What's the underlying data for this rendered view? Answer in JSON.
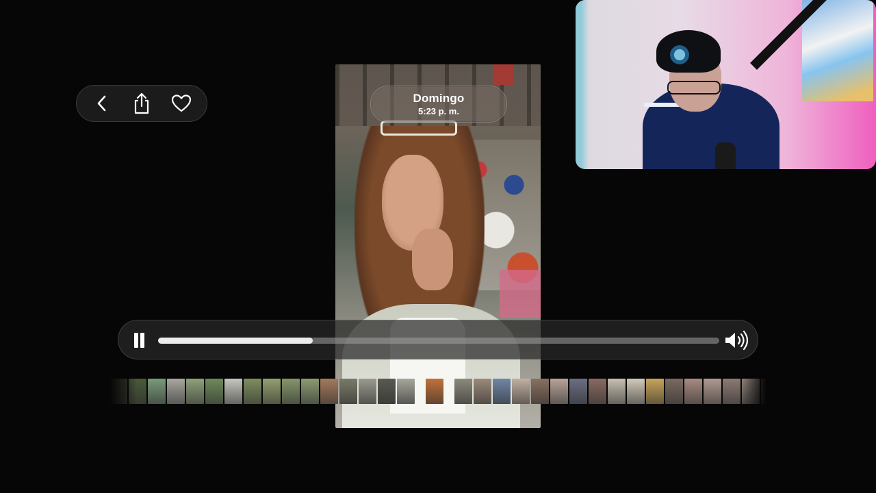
{
  "date_pill": {
    "day": "Domingo",
    "time": "5:23 p. m."
  },
  "navigation": {
    "back_icon": "chevron-left-icon",
    "share_icon": "share-icon",
    "favorite_icon": "heart-icon"
  },
  "player": {
    "state": "playing",
    "pause_icon": "pause-icon",
    "volume_icon": "speaker-wave-icon",
    "progress": 0.276
  },
  "colors": {
    "background": "#060606",
    "pill_background": "#1b1b1b",
    "track": "#a0a0a0",
    "track_fill": "#ececec"
  },
  "filmstrip": {
    "thumbnails": [
      {
        "kind": "photo",
        "color": "#3b3a30"
      },
      {
        "kind": "photo",
        "color": "#4a5a3a"
      },
      {
        "kind": "photo",
        "color": "#7a9a7a"
      },
      {
        "kind": "photo",
        "color": "#a8a8a0"
      },
      {
        "kind": "photo",
        "color": "#8fa17a"
      },
      {
        "kind": "photo",
        "color": "#6e8a5a"
      },
      {
        "kind": "photo",
        "color": "#c7c7bf"
      },
      {
        "kind": "photo",
        "color": "#7d8f5e"
      },
      {
        "kind": "photo",
        "color": "#93a06f"
      },
      {
        "kind": "photo",
        "color": "#86966a"
      },
      {
        "kind": "photo",
        "color": "#8c9a73"
      },
      {
        "kind": "photo",
        "color": "#a37a5c"
      },
      {
        "kind": "photo",
        "color": "#7a7a6a"
      },
      {
        "kind": "photo",
        "color": "#9a9a90"
      },
      {
        "kind": "photo",
        "color": "#5a5a52"
      },
      {
        "kind": "photo",
        "color": "#a6a69b"
      },
      {
        "kind": "gap",
        "color": ""
      },
      {
        "kind": "photo",
        "color": "#c0723a"
      },
      {
        "kind": "gap",
        "color": ""
      },
      {
        "kind": "photo",
        "color": "#8c8a7c"
      },
      {
        "kind": "photo",
        "color": "#9a8a7a"
      },
      {
        "kind": "photo",
        "color": "#6f86a6"
      },
      {
        "kind": "photo",
        "color": "#c2b0a2"
      },
      {
        "kind": "photo",
        "color": "#8a7060"
      },
      {
        "kind": "photo",
        "color": "#b7a49a"
      },
      {
        "kind": "photo",
        "color": "#6a6f82"
      },
      {
        "kind": "photo",
        "color": "#8a6a62"
      },
      {
        "kind": "photo",
        "color": "#c7c0b2"
      },
      {
        "kind": "photo",
        "color": "#d2c9b9"
      },
      {
        "kind": "photo",
        "color": "#c7a45a"
      },
      {
        "kind": "photo",
        "color": "#7a6a62"
      },
      {
        "kind": "photo",
        "color": "#a88a82"
      },
      {
        "kind": "photo",
        "color": "#b09a92"
      },
      {
        "kind": "photo",
        "color": "#8c7a72"
      },
      {
        "kind": "photo",
        "color": "#a0928a"
      },
      {
        "kind": "photo",
        "color": "#7a6258"
      }
    ]
  }
}
